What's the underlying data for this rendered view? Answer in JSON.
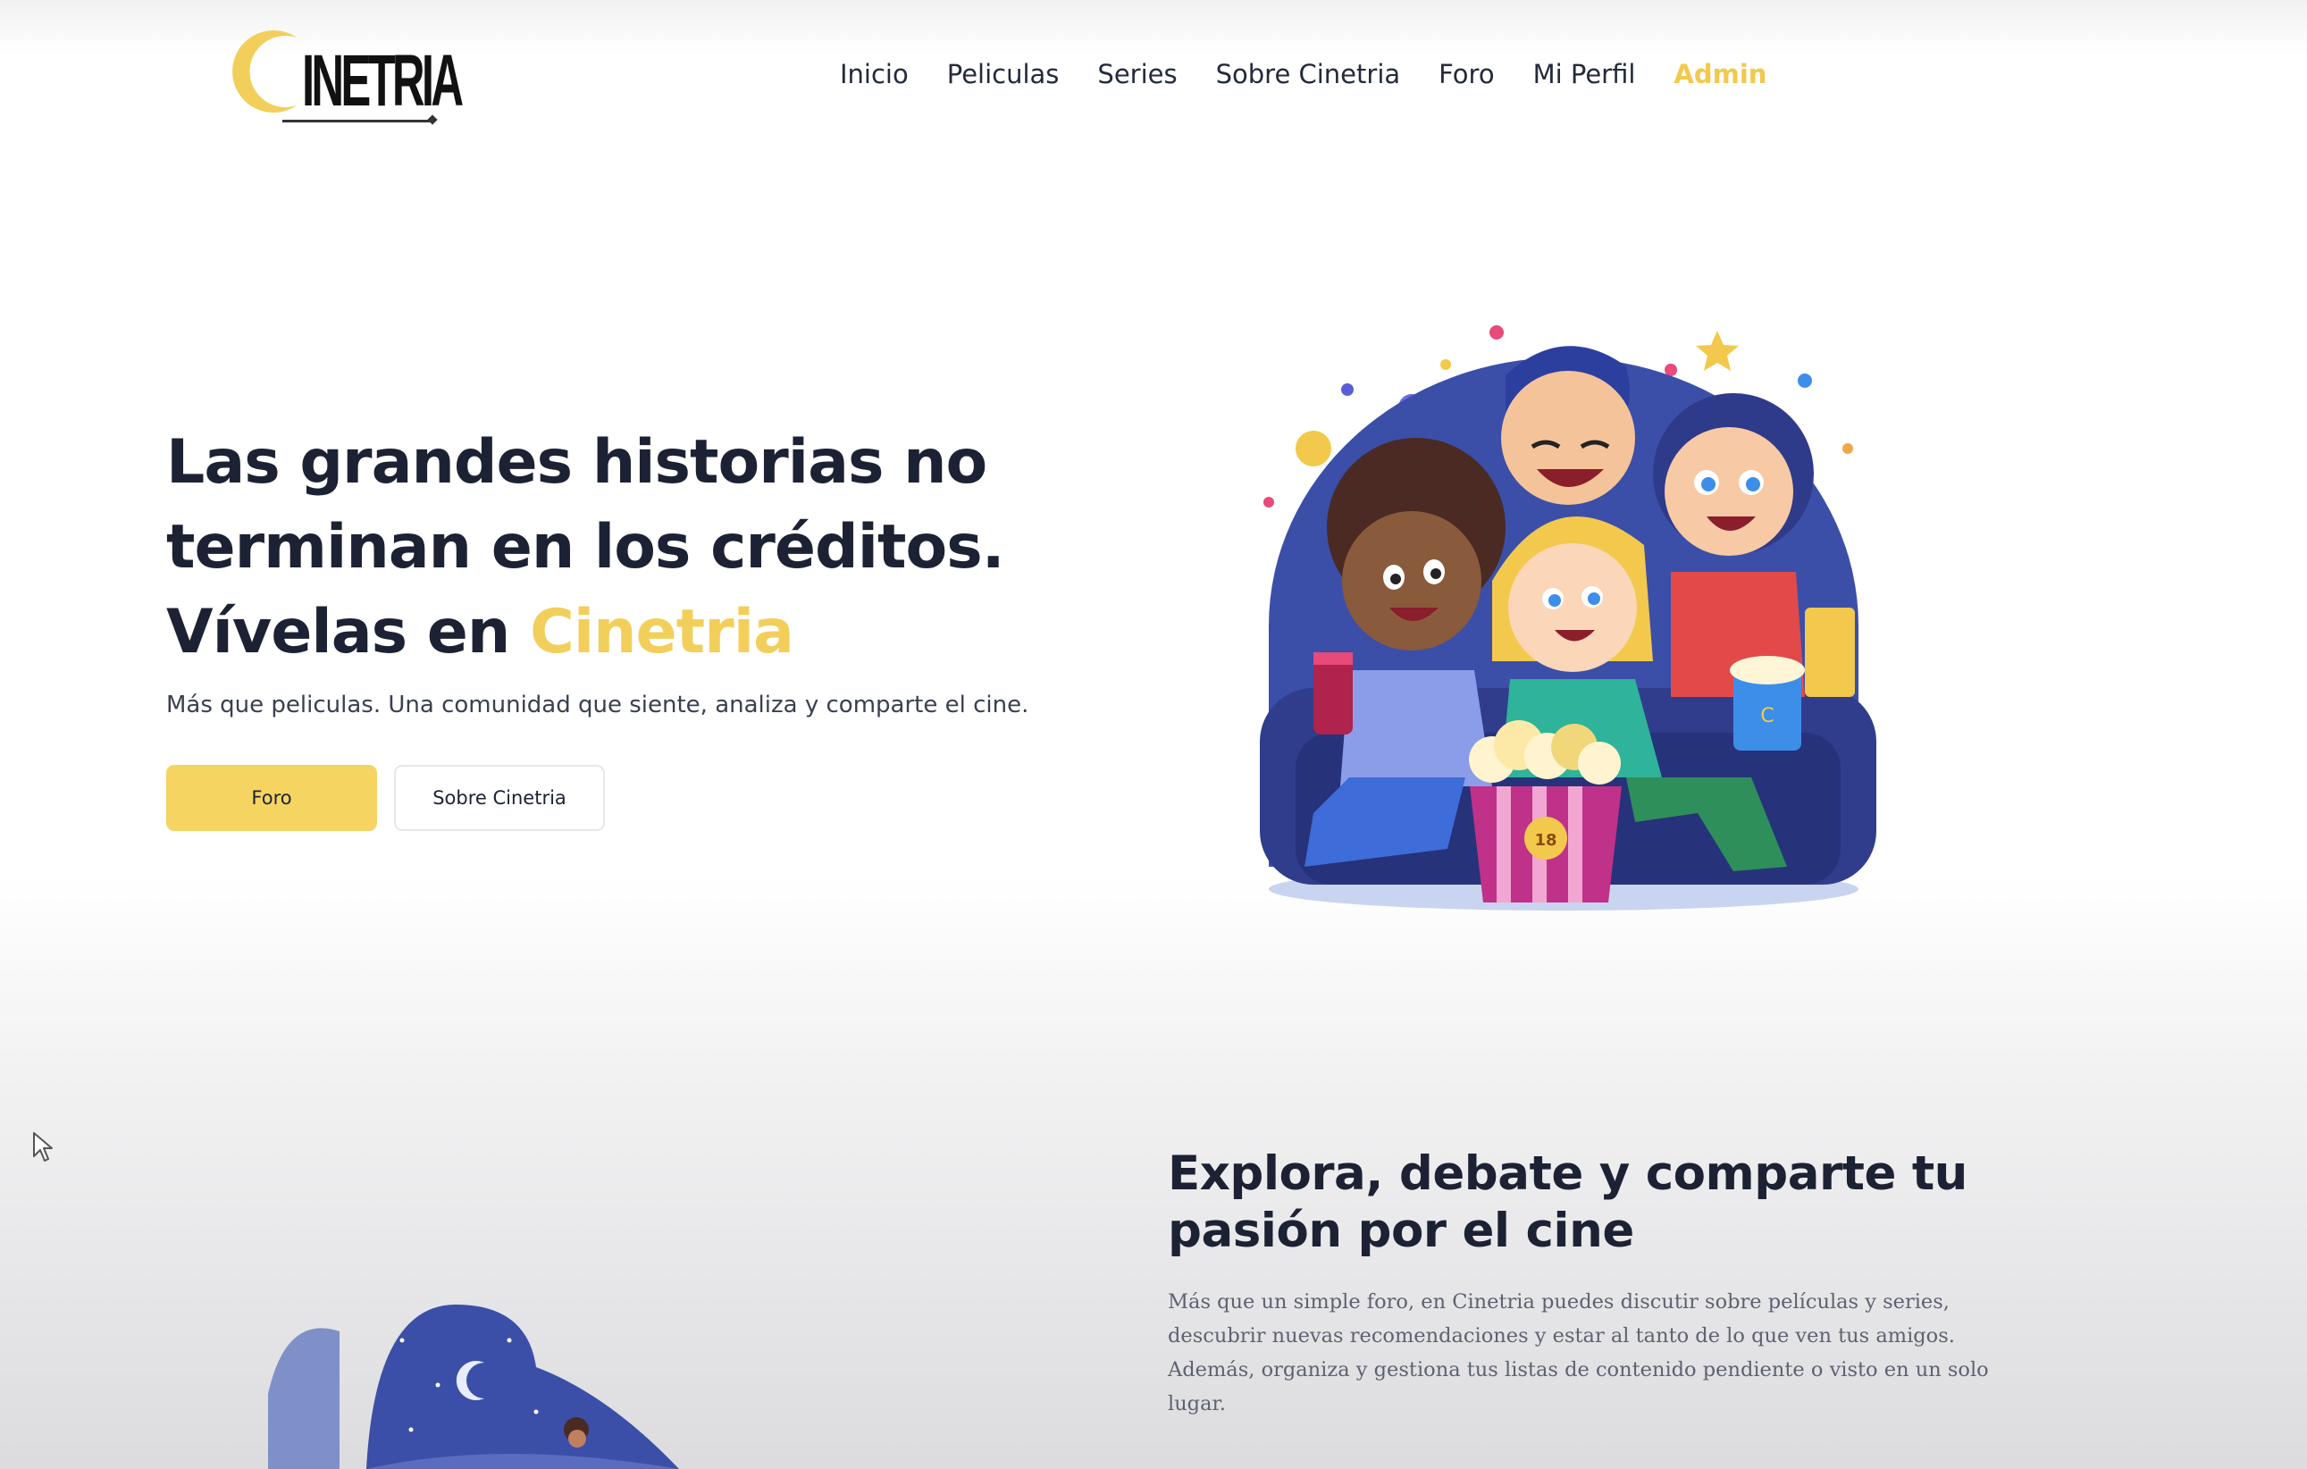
{
  "brand": {
    "logo_text": "INETRIA",
    "logo_color": "#f2cf5b"
  },
  "nav": {
    "items": [
      {
        "label": "Inicio"
      },
      {
        "label": "Peliculas"
      },
      {
        "label": "Series"
      },
      {
        "label": "Sobre Cinetria"
      },
      {
        "label": "Foro"
      },
      {
        "label": "Mi Perfil"
      },
      {
        "label": "Admin"
      }
    ]
  },
  "hero": {
    "title_line1": "Las grandes historias no",
    "title_line2": "terminan en los créditos.",
    "title_line3_prefix": "Vívelas en ",
    "title_accent": "Cinetria",
    "subtitle": "Más que peliculas. Una comunidad que siente, analiza y comparte el cine.",
    "primary_button": "Foro",
    "secondary_button": "Sobre Cinetria",
    "popcorn_badge": "18",
    "cup_badge": "C"
  },
  "section": {
    "title": "Explora, debate y comparte tu pasión por el cine",
    "body": "Más que un simple foro, en Cinetria puedes discutir sobre películas y series, descubrir nuevas recomendaciones y estar al tanto de lo que ven tus amigos. Además, organiza y gestiona tus listas de contenido pendiente o visto en un solo lugar."
  },
  "colors": {
    "accent": "#f5d462",
    "text_dark": "#1c2233",
    "illustration_blue": "#3b4fa8"
  },
  "icons": [
    "logo-c-icon",
    "cursor-icon",
    "star-icon",
    "moon-icon"
  ]
}
